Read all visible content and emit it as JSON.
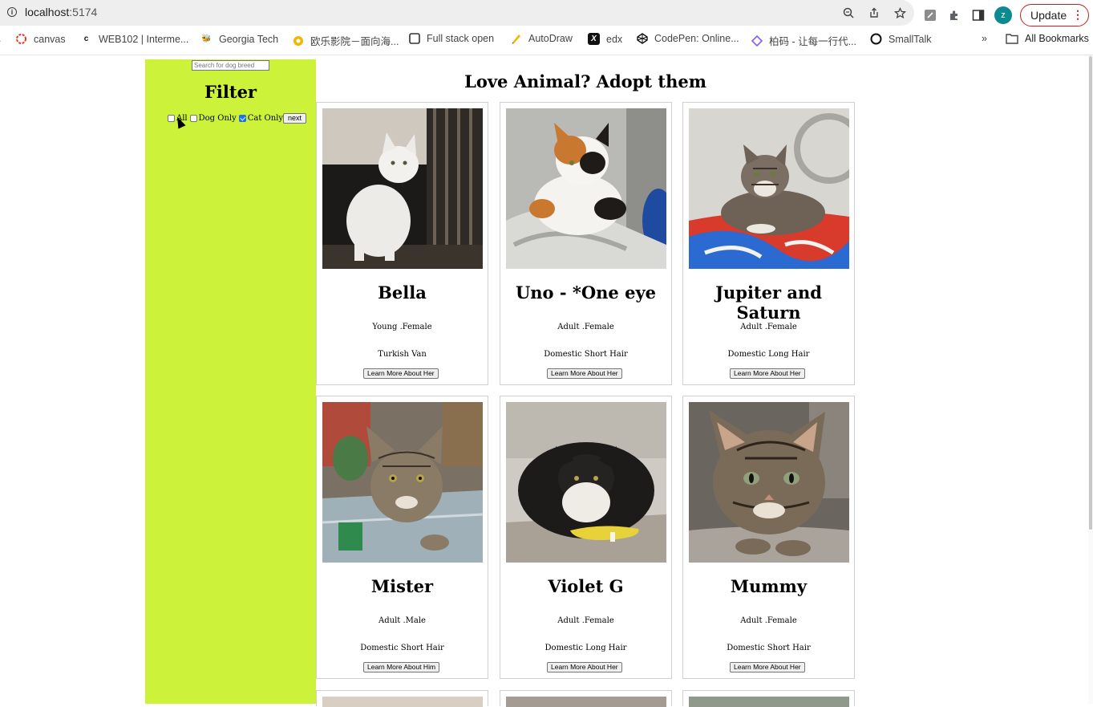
{
  "browser": {
    "url_host": "localhost",
    "url_port": ":5174",
    "update_label": "Update",
    "avatar_letter": "z",
    "bookmarks": [
      {
        "label": "canvas",
        "icon": "canvas-icon",
        "color": "#e03b24"
      },
      {
        "label": "WEB102 | Interme...",
        "icon": "codepath-icon",
        "color": "#111111"
      },
      {
        "label": "Georgia Tech",
        "icon": "georgia-tech-icon",
        "color": "#b3a369"
      },
      {
        "label": "欧乐影院－面向海...",
        "icon": "olevod-icon",
        "color": "#f2b705"
      },
      {
        "label": "Full stack open",
        "icon": "fullstack-icon",
        "color": "#333333"
      },
      {
        "label": "AutoDraw",
        "icon": "autodraw-icon",
        "color": "#f4b400"
      },
      {
        "label": "edx",
        "icon": "edx-icon",
        "color": "#111111"
      },
      {
        "label": "CodePen: Online...",
        "icon": "codepen-icon",
        "color": "#111111"
      },
      {
        "label": "柏码 - 让每一行代...",
        "icon": "itbaima-icon",
        "color": "#8a5cf6"
      },
      {
        "label": "SmallTalk",
        "icon": "smalltalk-icon",
        "color": "#111111"
      }
    ],
    "all_bookmarks_label": "All Bookmarks"
  },
  "sidebar": {
    "search_placeholder": "Search for dog breed",
    "filter_title": "Filter",
    "options": [
      {
        "label": "All",
        "checked": false
      },
      {
        "label": "Dog Only",
        "checked": false
      },
      {
        "label": "Cat Only",
        "checked": true
      }
    ],
    "next_label": "next"
  },
  "main": {
    "title": "Love Animal? Adopt them",
    "pets": [
      {
        "name": "Bella",
        "meta": "Young .Female",
        "breed": "Turkish Van",
        "button": "Learn More About Her"
      },
      {
        "name": "Uno - *One eye",
        "meta": "Adult .Female",
        "breed": "Domestic Short Hair",
        "button": "Learn More About Her"
      },
      {
        "name": "Jupiter and Saturn",
        "meta": "Adult .Female",
        "breed": "Domestic Long Hair",
        "button": "Learn More About Her"
      },
      {
        "name": "Mister",
        "meta": "Adult .Male",
        "breed": "Domestic Short Hair",
        "button": "Learn More About Him"
      },
      {
        "name": "Violet G",
        "meta": "Adult .Female",
        "breed": "Domestic Long Hair",
        "button": "Learn More About Her"
      },
      {
        "name": "Mummy",
        "meta": "Adult .Female",
        "breed": "Domestic Short Hair",
        "button": "Learn More About Her"
      }
    ]
  },
  "colors": {
    "sidebar_bg": "#ccf23a",
    "checkbox_accent": "#1a73e8"
  }
}
